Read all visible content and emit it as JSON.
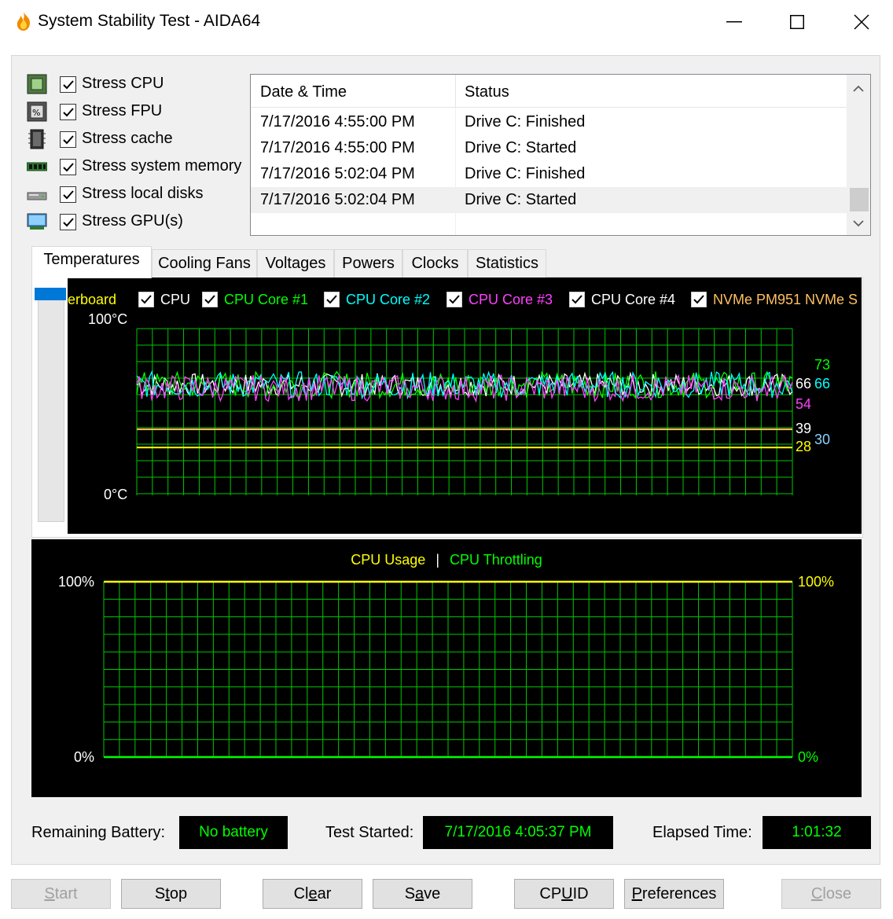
{
  "window": {
    "title": "System Stability Test - AIDA64",
    "minimize_icon": "minimize-icon",
    "maximize_icon": "maximize-icon",
    "close_icon": "close-icon"
  },
  "stress_options": [
    {
      "label": "Stress CPU",
      "checked": true,
      "icon": "cpu-icon"
    },
    {
      "label": "Stress FPU",
      "checked": true,
      "icon": "fpu-icon"
    },
    {
      "label": "Stress cache",
      "checked": true,
      "icon": "cache-icon"
    },
    {
      "label": "Stress system memory",
      "checked": true,
      "icon": "memory-icon"
    },
    {
      "label": "Stress local disks",
      "checked": true,
      "icon": "disk-icon"
    },
    {
      "label": "Stress GPU(s)",
      "checked": true,
      "icon": "gpu-icon"
    }
  ],
  "log": {
    "columns": [
      "Date & Time",
      "Status"
    ],
    "rows": [
      {
        "datetime": "7/17/2016 4:55:00 PM",
        "status": "Drive C: Finished"
      },
      {
        "datetime": "7/17/2016 4:55:00 PM",
        "status": "Drive C: Started"
      },
      {
        "datetime": "7/17/2016 5:02:04 PM",
        "status": "Drive C: Finished"
      },
      {
        "datetime": "7/17/2016 5:02:04 PM",
        "status": "Drive C: Started"
      }
    ]
  },
  "tabs": [
    "Temperatures",
    "Cooling Fans",
    "Voltages",
    "Powers",
    "Clocks",
    "Statistics"
  ],
  "active_tab": "Temperatures",
  "chart_data": [
    {
      "type": "line",
      "legend_placement": "top",
      "legend": [
        {
          "name": "erboard",
          "color": "#ffff00",
          "checked": null
        },
        {
          "name": "CPU",
          "color": "#ffffff",
          "checked": true
        },
        {
          "name": "CPU Core #1",
          "color": "#00ff00",
          "checked": true
        },
        {
          "name": "CPU Core #2",
          "color": "#00ffff",
          "checked": true
        },
        {
          "name": "CPU Core #3",
          "color": "#ff40ff",
          "checked": true
        },
        {
          "name": "CPU Core #4",
          "color": "#ffffff",
          "checked": true
        },
        {
          "name": "NVMe PM951 NVMe S",
          "color": "#ffc060",
          "checked": true
        }
      ],
      "y_top_label": "100°C",
      "y_bottom_label": "0°C",
      "ylim": [
        0,
        100
      ],
      "grid": true,
      "grid_color": "#00c800",
      "series": [
        {
          "name": "CPU",
          "color": "#ffffff",
          "approx": 66,
          "spread": 7
        },
        {
          "name": "CPU Core #1",
          "color": "#00ff00",
          "approx": 66,
          "spread": 8
        },
        {
          "name": "CPU Core #2",
          "color": "#00ffff",
          "approx": 66,
          "spread": 8
        },
        {
          "name": "CPU Core #3",
          "color": "#ff40ff",
          "approx": 64,
          "spread": 8
        },
        {
          "name": "NVMe PM951 NVMe S",
          "color": "#ffc060",
          "approx": 39,
          "spread": 0
        },
        {
          "name": "erboard",
          "color": "#ffff00",
          "approx": 28,
          "spread": 0
        }
      ],
      "value_labels": [
        {
          "text": "73",
          "color": "#00ff00",
          "value": 73
        },
        {
          "text": "66",
          "color": "#ffffff",
          "value": 66
        },
        {
          "text": "66",
          "color": "#00ffff",
          "value": 66
        },
        {
          "text": "54",
          "color": "#ff40ff",
          "value": 54
        },
        {
          "text": "39",
          "color": "#ffffff",
          "value": 39
        },
        {
          "text": "28",
          "color": "#ffff00",
          "value": 28
        },
        {
          "text": "30",
          "color": "#8fd0ff",
          "value": 30
        }
      ]
    },
    {
      "type": "line",
      "title_parts": [
        {
          "text": "CPU Usage",
          "color": "#ffff00"
        },
        {
          "text": "|",
          "color": "#ffffff"
        },
        {
          "text": "CPU Throttling",
          "color": "#00ff00"
        }
      ],
      "y_top_label_left": "100%",
      "y_bottom_label_left": "0%",
      "y_top_label_right": "100%",
      "y_bottom_label_right": "0%",
      "ylim": [
        0,
        100
      ],
      "grid": true,
      "grid_color": "#00c800",
      "series": [
        {
          "name": "CPU Usage",
          "color": "#ffff00",
          "values_constant": 100
        },
        {
          "name": "CPU Throttling",
          "color": "#00ff00",
          "values_constant": 0
        }
      ]
    }
  ],
  "status": {
    "battery_label": "Remaining Battery:",
    "battery_value": "No battery",
    "started_label": "Test Started:",
    "started_value": "7/17/2016 4:05:37 PM",
    "elapsed_label": "Elapsed Time:",
    "elapsed_value": "1:01:32"
  },
  "buttons": [
    {
      "key": "start",
      "label": "Start",
      "mnemonic": "S",
      "enabled": false
    },
    {
      "key": "stop",
      "label": "Stop",
      "mnemonic": "t",
      "enabled": true
    },
    {
      "key": "clear",
      "label": "Clear",
      "mnemonic": "e",
      "enabled": true
    },
    {
      "key": "save",
      "label": "Save",
      "mnemonic": "a",
      "enabled": true
    },
    {
      "key": "cpuid",
      "label": "CPUID",
      "mnemonic": "U",
      "enabled": true
    },
    {
      "key": "preferences",
      "label": "Preferences",
      "mnemonic": "P",
      "enabled": true
    },
    {
      "key": "close",
      "label": "Close",
      "mnemonic": "C",
      "enabled": false
    }
  ]
}
